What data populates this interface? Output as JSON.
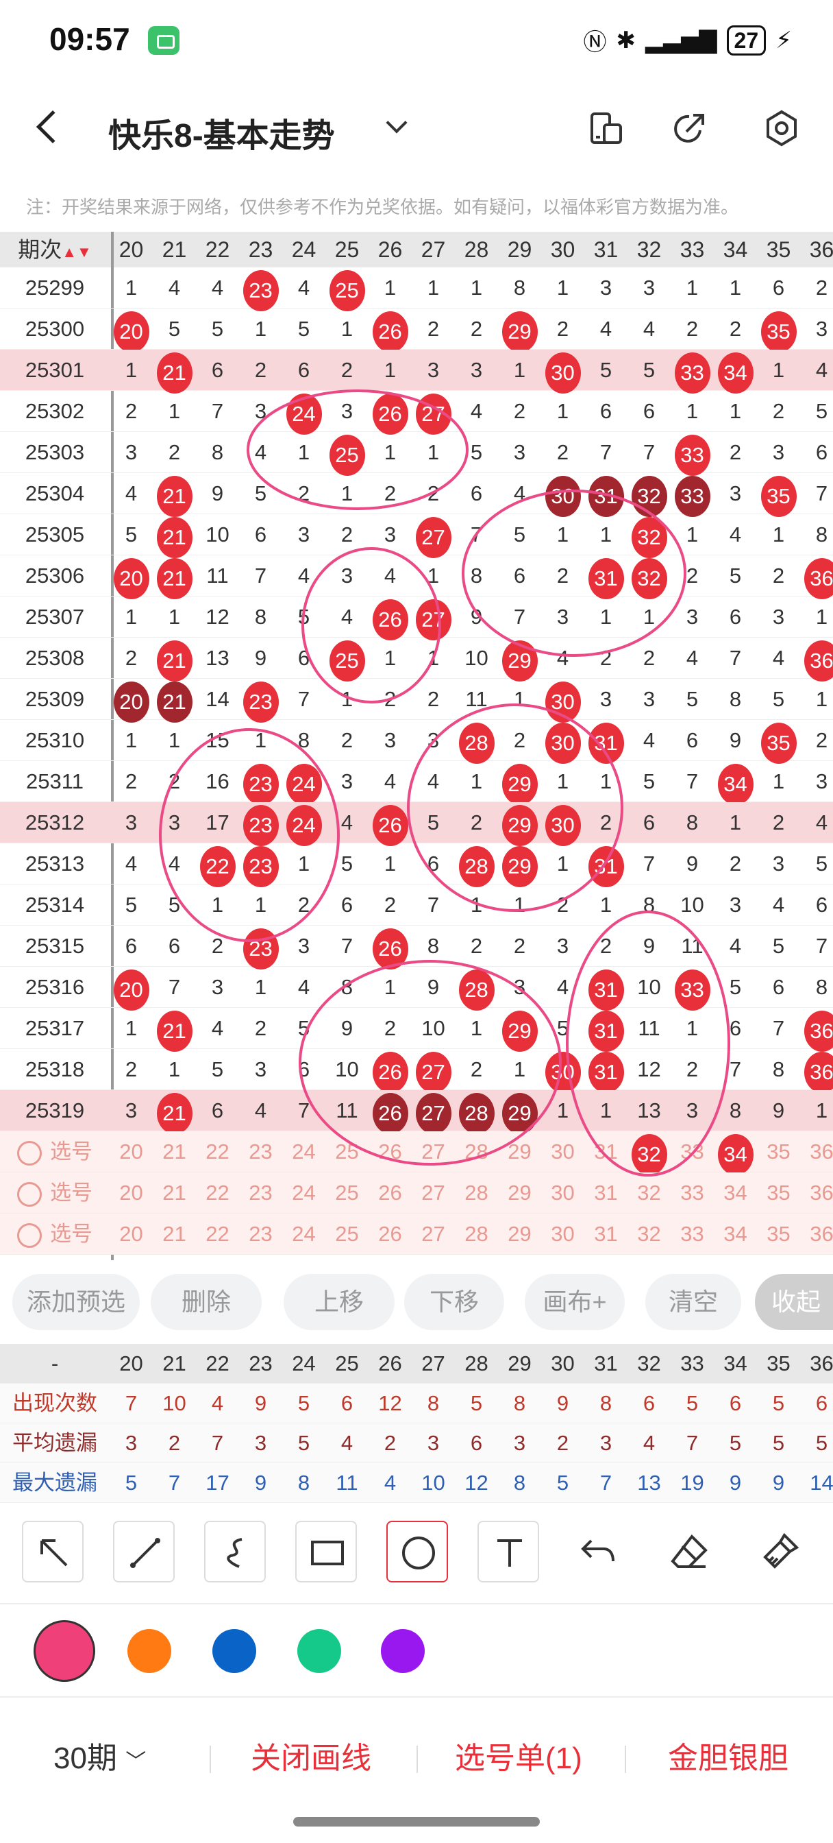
{
  "status": {
    "time": "09:57",
    "battery": "27",
    "icons": [
      "nfc-icon",
      "bluetooth-icon",
      "signal-icon",
      "battery-icon",
      "charging-icon"
    ]
  },
  "header": {
    "title": "快乐8-基本走势"
  },
  "notice": "注：开奖结果来源于网络，仅供参考不作为兑奖依据。如有疑问，以福体彩官方数据为准。",
  "grid": {
    "issue_header": "期次",
    "columns": [
      "20",
      "21",
      "22",
      "23",
      "24",
      "25",
      "26",
      "27",
      "28",
      "29",
      "30",
      "31",
      "32",
      "33",
      "34",
      "35",
      "36"
    ],
    "rows": [
      {
        "issue": "25299",
        "cells": [
          "1",
          "4",
          "4",
          "23",
          "4",
          "25",
          "1",
          "1",
          "1",
          "8",
          "1",
          "3",
          "3",
          "1",
          "1",
          "6",
          "2"
        ],
        "balls": [
          3,
          5
        ]
      },
      {
        "issue": "25300",
        "cells": [
          "20",
          "5",
          "5",
          "1",
          "5",
          "1",
          "26",
          "2",
          "2",
          "29",
          "2",
          "4",
          "4",
          "2",
          "2",
          "35",
          "3"
        ],
        "balls": [
          0,
          6,
          9,
          15
        ]
      },
      {
        "issue": "25301",
        "cells": [
          "1",
          "21",
          "6",
          "2",
          "6",
          "2",
          "1",
          "3",
          "3",
          "1",
          "30",
          "5",
          "5",
          "33",
          "34",
          "1",
          "4"
        ],
        "balls": [
          1,
          10,
          13,
          14
        ],
        "hl": true
      },
      {
        "issue": "25302",
        "cells": [
          "2",
          "1",
          "7",
          "3",
          "24",
          "3",
          "26",
          "27",
          "4",
          "2",
          "1",
          "6",
          "6",
          "1",
          "1",
          "2",
          "5"
        ],
        "balls": [
          4,
          6,
          7
        ]
      },
      {
        "issue": "25303",
        "cells": [
          "3",
          "2",
          "8",
          "4",
          "1",
          "25",
          "1",
          "1",
          "5",
          "3",
          "2",
          "7",
          "7",
          "33",
          "2",
          "3",
          "6"
        ],
        "balls": [
          5,
          13
        ]
      },
      {
        "issue": "25304",
        "cells": [
          "4",
          "21",
          "9",
          "5",
          "2",
          "1",
          "2",
          "2",
          "6",
          "4",
          "30",
          "31",
          "32",
          "33",
          "3",
          "35",
          "7"
        ],
        "balls": [
          1,
          15
        ],
        "dark": [
          10,
          11,
          12,
          13
        ]
      },
      {
        "issue": "25305",
        "cells": [
          "5",
          "21",
          "10",
          "6",
          "3",
          "2",
          "3",
          "27",
          "7",
          "5",
          "1",
          "1",
          "32",
          "1",
          "4",
          "1",
          "8"
        ],
        "balls": [
          1,
          7,
          12
        ]
      },
      {
        "issue": "25306",
        "cells": [
          "20",
          "21",
          "11",
          "7",
          "4",
          "3",
          "4",
          "1",
          "8",
          "6",
          "2",
          "31",
          "32",
          "2",
          "5",
          "2",
          "36"
        ],
        "balls": [
          0,
          1,
          11,
          12,
          16
        ]
      },
      {
        "issue": "25307",
        "cells": [
          "1",
          "1",
          "12",
          "8",
          "5",
          "4",
          "26",
          "27",
          "9",
          "7",
          "3",
          "1",
          "1",
          "3",
          "6",
          "3",
          "1"
        ],
        "balls": [
          6,
          7
        ]
      },
      {
        "issue": "25308",
        "cells": [
          "2",
          "21",
          "13",
          "9",
          "6",
          "25",
          "1",
          "1",
          "10",
          "29",
          "4",
          "2",
          "2",
          "4",
          "7",
          "4",
          "36"
        ],
        "balls": [
          1,
          5,
          9,
          16
        ]
      },
      {
        "issue": "25309",
        "cells": [
          "20",
          "21",
          "14",
          "23",
          "7",
          "1",
          "2",
          "2",
          "11",
          "1",
          "30",
          "3",
          "3",
          "5",
          "8",
          "5",
          "1"
        ],
        "balls": [
          3,
          10
        ],
        "dark": [
          0,
          1
        ]
      },
      {
        "issue": "25310",
        "cells": [
          "1",
          "1",
          "15",
          "1",
          "8",
          "2",
          "3",
          "3",
          "28",
          "2",
          "30",
          "31",
          "4",
          "6",
          "9",
          "35",
          "2"
        ],
        "balls": [
          8,
          10,
          11,
          15
        ]
      },
      {
        "issue": "25311",
        "cells": [
          "2",
          "2",
          "16",
          "23",
          "24",
          "3",
          "4",
          "4",
          "1",
          "29",
          "1",
          "1",
          "5",
          "7",
          "34",
          "1",
          "3"
        ],
        "balls": [
          3,
          4,
          9,
          14
        ]
      },
      {
        "issue": "25312",
        "cells": [
          "3",
          "3",
          "17",
          "23",
          "24",
          "4",
          "26",
          "5",
          "2",
          "29",
          "30",
          "2",
          "6",
          "8",
          "1",
          "2",
          "4"
        ],
        "balls": [
          3,
          4,
          6,
          9,
          10
        ],
        "hl": true
      },
      {
        "issue": "25313",
        "cells": [
          "4",
          "4",
          "22",
          "23",
          "1",
          "5",
          "1",
          "6",
          "28",
          "29",
          "1",
          "31",
          "7",
          "9",
          "2",
          "3",
          "5"
        ],
        "balls": [
          2,
          3,
          8,
          9,
          11
        ]
      },
      {
        "issue": "25314",
        "cells": [
          "5",
          "5",
          "1",
          "1",
          "2",
          "6",
          "2",
          "7",
          "1",
          "1",
          "2",
          "1",
          "8",
          "10",
          "3",
          "4",
          "6"
        ],
        "balls": []
      },
      {
        "issue": "25315",
        "cells": [
          "6",
          "6",
          "2",
          "23",
          "3",
          "7",
          "26",
          "8",
          "2",
          "2",
          "3",
          "2",
          "9",
          "11",
          "4",
          "5",
          "7"
        ],
        "balls": [
          3,
          6
        ]
      },
      {
        "issue": "25316",
        "cells": [
          "20",
          "7",
          "3",
          "1",
          "4",
          "8",
          "1",
          "9",
          "28",
          "3",
          "4",
          "31",
          "10",
          "33",
          "5",
          "6",
          "8"
        ],
        "balls": [
          0,
          8,
          11,
          13
        ]
      },
      {
        "issue": "25317",
        "cells": [
          "1",
          "21",
          "4",
          "2",
          "5",
          "9",
          "2",
          "10",
          "1",
          "29",
          "5",
          "31",
          "11",
          "1",
          "6",
          "7",
          "36"
        ],
        "balls": [
          1,
          9,
          11,
          16
        ]
      },
      {
        "issue": "25318",
        "cells": [
          "2",
          "1",
          "5",
          "3",
          "6",
          "10",
          "26",
          "27",
          "2",
          "1",
          "30",
          "31",
          "12",
          "2",
          "7",
          "8",
          "36"
        ],
        "balls": [
          6,
          7,
          10,
          11,
          16
        ]
      },
      {
        "issue": "25319",
        "cells": [
          "3",
          "21",
          "6",
          "4",
          "7",
          "11",
          "26",
          "27",
          "28",
          "29",
          "1",
          "1",
          "13",
          "3",
          "8",
          "9",
          "1"
        ],
        "balls": [
          1
        ],
        "dark": [
          6,
          7,
          8,
          9
        ],
        "hl": true
      }
    ],
    "select_label": "选号",
    "select_rows": [
      {
        "cells": [
          "20",
          "21",
          "22",
          "23",
          "24",
          "25",
          "26",
          "27",
          "28",
          "29",
          "30",
          "31",
          "32",
          "33",
          "34",
          "35",
          "36"
        ],
        "balls": [
          12,
          14
        ]
      },
      {
        "cells": [
          "20",
          "21",
          "22",
          "23",
          "24",
          "25",
          "26",
          "27",
          "28",
          "29",
          "30",
          "31",
          "32",
          "33",
          "34",
          "35",
          "36"
        ],
        "balls": []
      },
      {
        "cells": [
          "20",
          "21",
          "22",
          "23",
          "24",
          "25",
          "26",
          "27",
          "28",
          "29",
          "30",
          "31",
          "32",
          "33",
          "34",
          "35",
          "36"
        ],
        "balls": []
      }
    ]
  },
  "tools": [
    "添加预选",
    "删除",
    "上移",
    "下移",
    "画布+",
    "清空",
    "收起"
  ],
  "stats": {
    "header_dash": "-",
    "rows": [
      {
        "label": "出现次数",
        "color": "#c0392b",
        "values": [
          "7",
          "10",
          "4",
          "9",
          "5",
          "6",
          "12",
          "8",
          "5",
          "8",
          "9",
          "8",
          "6",
          "5",
          "6",
          "5",
          "6"
        ]
      },
      {
        "label": "平均遗漏",
        "color": "#8e2b2b",
        "values": [
          "3",
          "2",
          "7",
          "3",
          "5",
          "4",
          "2",
          "3",
          "6",
          "3",
          "2",
          "3",
          "4",
          "7",
          "5",
          "5",
          "5"
        ]
      },
      {
        "label": "最大遗漏",
        "color": "#2f5fb3",
        "values": [
          "5",
          "7",
          "17",
          "9",
          "8",
          "11",
          "4",
          "10",
          "12",
          "8",
          "5",
          "7",
          "13",
          "19",
          "9",
          "9",
          "14"
        ]
      }
    ]
  },
  "draw_tools": [
    "arrow-icon",
    "line-icon",
    "curve-icon",
    "rectangle-icon",
    "circle-icon",
    "text-icon",
    "undo-icon",
    "eraser-icon",
    "clear-brush-icon"
  ],
  "colors": [
    "#f0407a",
    "#ff7a12",
    "#0a64c8",
    "#15c98b",
    "#9a18f0"
  ],
  "bottom": {
    "period": "30期",
    "close": "关闭画线",
    "ticket": "选号单(1)",
    "gold": "金胆银胆"
  }
}
